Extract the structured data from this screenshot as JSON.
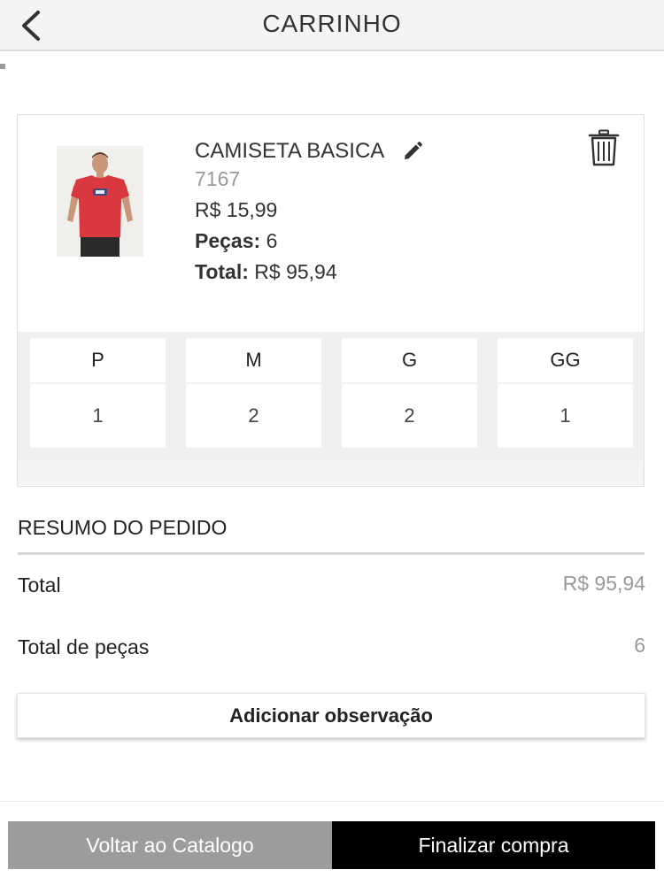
{
  "header": {
    "title": "CARRINHO",
    "back_icon": "chevron-left-icon"
  },
  "product": {
    "name": "CAMISETA BASICA",
    "code": "7167",
    "price": "R$ 15,99",
    "pieces_label": "Peças:",
    "pieces_value": "6",
    "total_label": "Total:",
    "total_value": "R$ 95,94",
    "edit_icon": "pencil-icon",
    "delete_icon": "trash-icon",
    "image": "red-tshirt-model-photo",
    "sizes": [
      {
        "size": "P",
        "qty": "1"
      },
      {
        "size": "M",
        "qty": "2"
      },
      {
        "size": "G",
        "qty": "2"
      },
      {
        "size": "GG",
        "qty": "1"
      }
    ]
  },
  "summary": {
    "title": "RESUMO DO PEDIDO",
    "total_label": "Total",
    "total_value": "R$ 95,94",
    "pieces_label": "Total de peças",
    "pieces_value": "6"
  },
  "actions": {
    "add_note": "Adicionar observação",
    "back_to_catalog": "Voltar ao Catalogo",
    "finish_purchase": "Finalizar compra"
  },
  "colors": {
    "header_bg": "#f5f4f5",
    "back_catalog_bg": "#9c9c9c",
    "finish_bg": "#000000",
    "muted_text": "#9a9a9a"
  }
}
